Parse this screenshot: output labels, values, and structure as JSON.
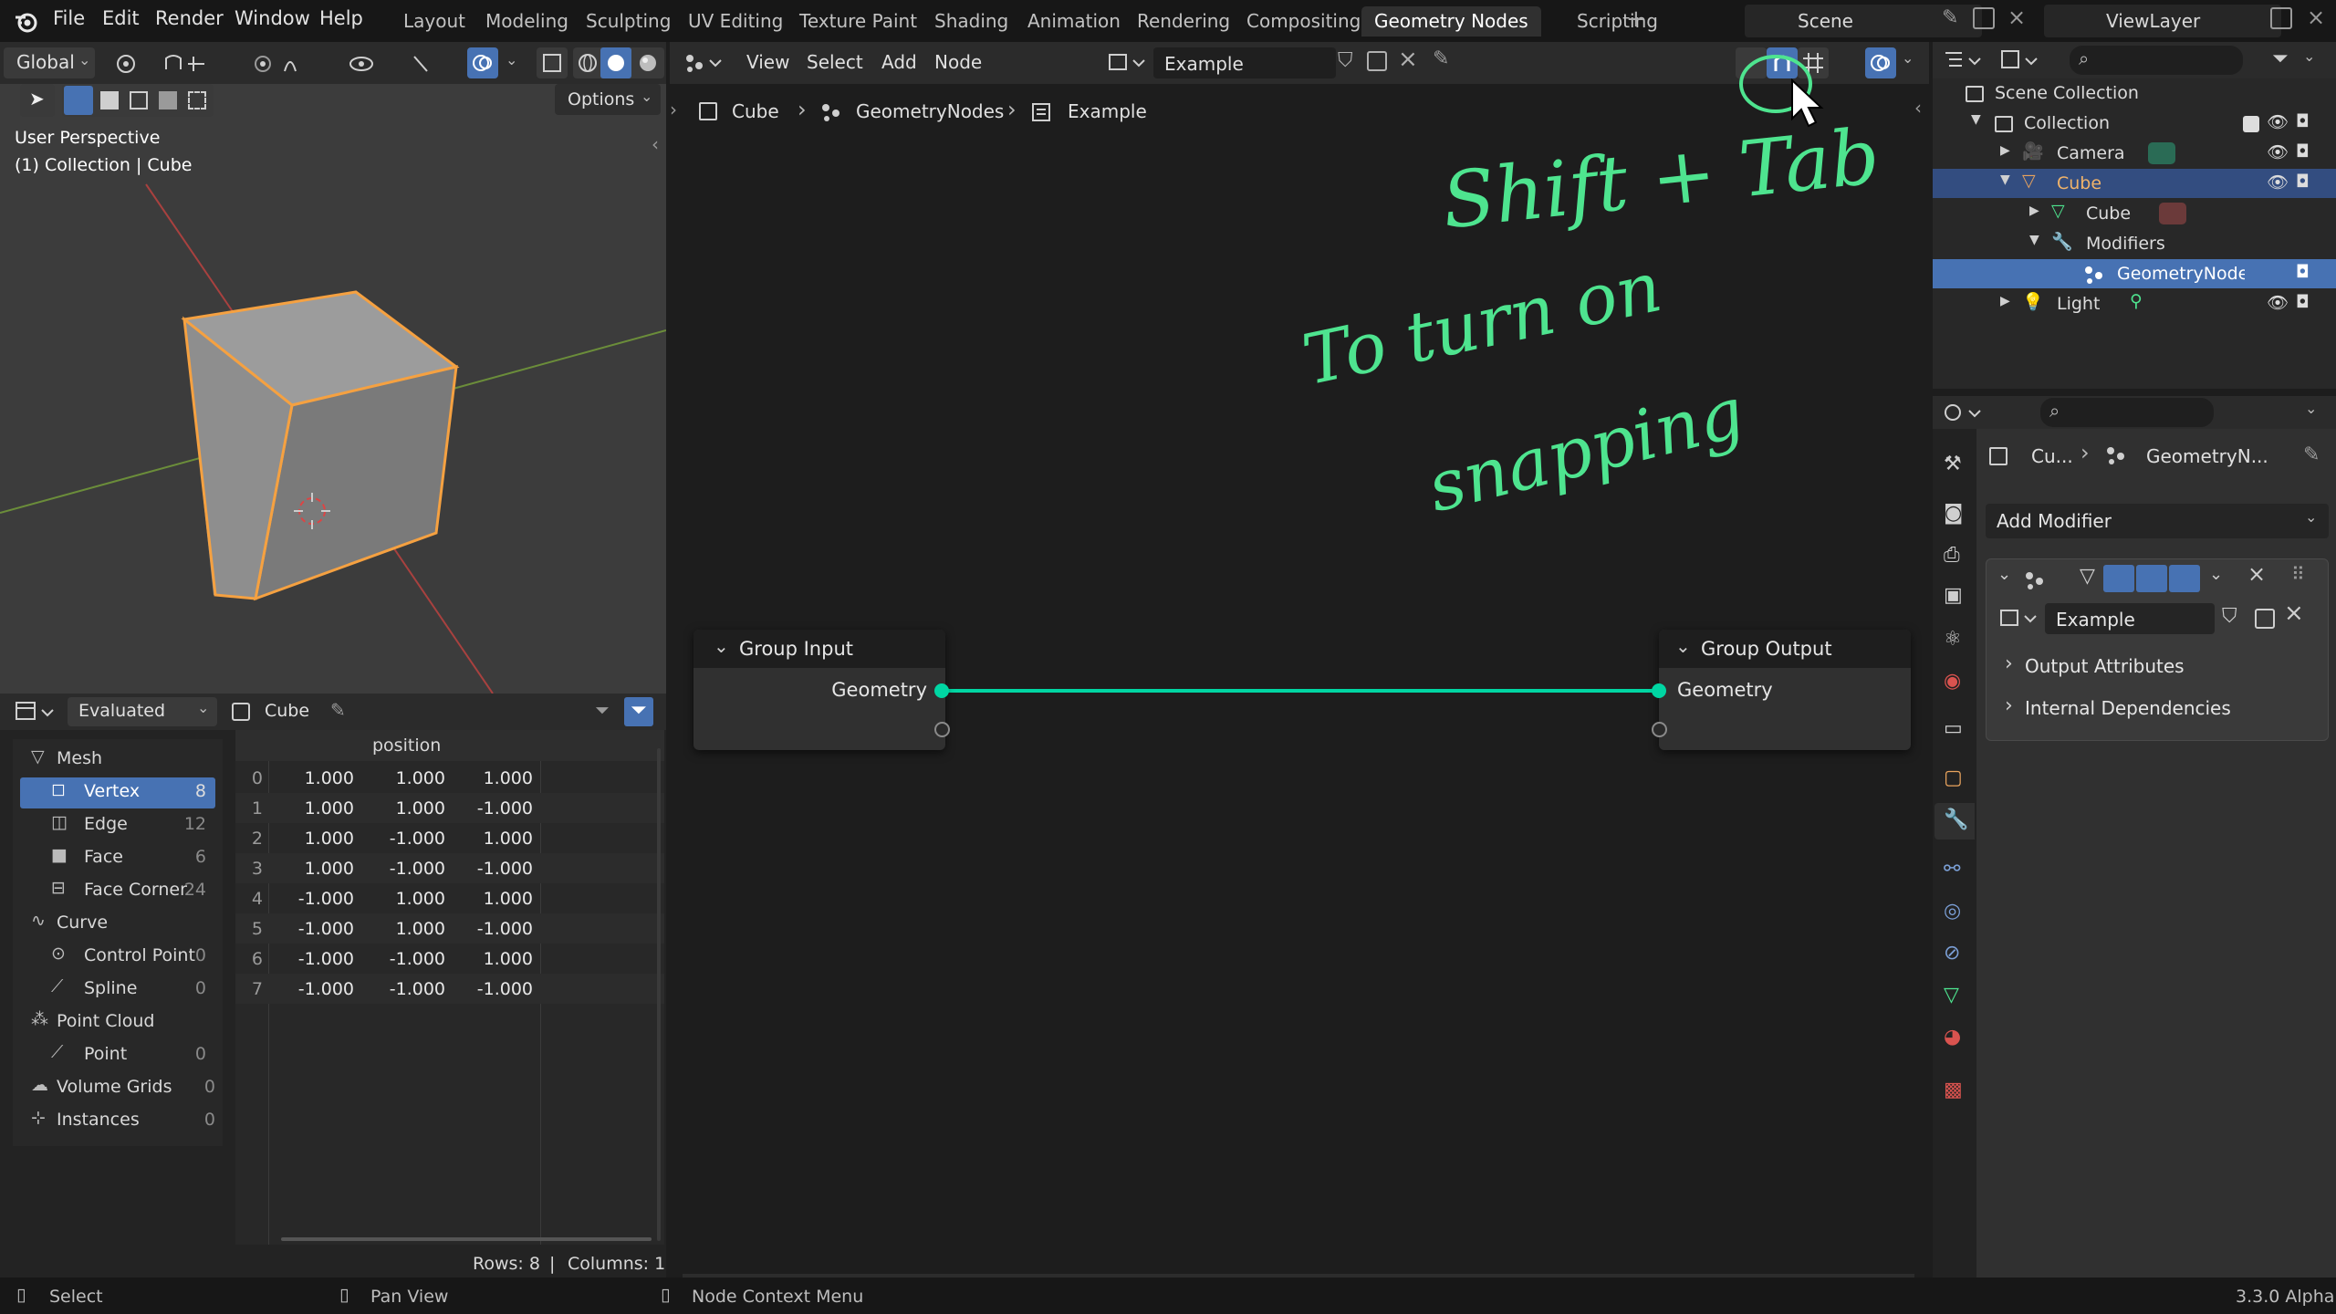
{
  "menu": {
    "file": "File",
    "edit": "Edit",
    "render": "Render",
    "window": "Window",
    "help": "Help"
  },
  "workspaces": [
    "Layout",
    "Modeling",
    "Sculpting",
    "UV Editing",
    "Texture Paint",
    "Shading",
    "Animation",
    "Rendering",
    "Compositing",
    "Geometry Nodes",
    "Scripting"
  ],
  "scene": {
    "name": "Scene",
    "view_layer": "ViewLayer"
  },
  "viewport": {
    "orientation": "Global",
    "options_label": "Options",
    "perspective_label": "User Perspective",
    "collection_label": "(1) Collection | Cube"
  },
  "node_header": {
    "view": "View",
    "select": "Select",
    "add": "Add",
    "node": "Node",
    "tree_name": "Example"
  },
  "breadcrumb": {
    "object": "Cube",
    "modifier": "GeometryNodes",
    "tree": "Example"
  },
  "annotation": {
    "line1": "Shift + Tab",
    "line2": "To turn on",
    "line3": "snapping"
  },
  "nodes": {
    "group_input": {
      "title": "Group Input",
      "socket": "Geometry"
    },
    "group_output": {
      "title": "Group Output",
      "socket": "Geometry"
    }
  },
  "spreadsheet": {
    "mode": "Evaluated",
    "object": "Cube",
    "column_header": "position",
    "tree": [
      {
        "label": "Mesh",
        "count": ""
      },
      {
        "label": "Vertex",
        "count": "8"
      },
      {
        "label": "Edge",
        "count": "12"
      },
      {
        "label": "Face",
        "count": "6"
      },
      {
        "label": "Face Corner",
        "count": "24"
      },
      {
        "label": "Curve",
        "count": ""
      },
      {
        "label": "Control Point",
        "count": "0"
      },
      {
        "label": "Spline",
        "count": "0"
      },
      {
        "label": "Point Cloud",
        "count": ""
      },
      {
        "label": "Point",
        "count": "0"
      },
      {
        "label": "Volume Grids",
        "count": "0"
      },
      {
        "label": "Instances",
        "count": "0"
      }
    ],
    "rows": [
      {
        "i": "0",
        "x": "1.000",
        "y": "1.000",
        "z": "1.000"
      },
      {
        "i": "1",
        "x": "1.000",
        "y": "1.000",
        "z": "-1.000"
      },
      {
        "i": "2",
        "x": "1.000",
        "y": "-1.000",
        "z": "1.000"
      },
      {
        "i": "3",
        "x": "1.000",
        "y": "-1.000",
        "z": "-1.000"
      },
      {
        "i": "4",
        "x": "-1.000",
        "y": "1.000",
        "z": "1.000"
      },
      {
        "i": "5",
        "x": "-1.000",
        "y": "1.000",
        "z": "-1.000"
      },
      {
        "i": "6",
        "x": "-1.000",
        "y": "-1.000",
        "z": "1.000"
      },
      {
        "i": "7",
        "x": "-1.000",
        "y": "-1.000",
        "z": "-1.000"
      }
    ],
    "footer_rows": "Rows: 8",
    "footer_sep": "|",
    "footer_cols": "Columns: 1"
  },
  "outliner": {
    "scene_collection": "Scene Collection",
    "collection": "Collection",
    "camera": "Camera",
    "cube": "Cube",
    "cube_mesh": "Cube",
    "modifiers": "Modifiers",
    "geonodes": "GeometryNode",
    "light": "Light"
  },
  "properties": {
    "breadcrumb_object": "Cu...",
    "breadcrumb_modifier": "GeometryN...",
    "add_modifier": "Add Modifier",
    "tree_name": "Example",
    "output_attributes": "Output Attributes",
    "internal_dependencies": "Internal Dependencies"
  },
  "status": {
    "select": "Select",
    "pan_view": "Pan View",
    "context_menu": "Node Context Menu",
    "version": "3.3.0 Alpha"
  },
  "colors": {
    "accent": "#4772b3",
    "geometry_socket": "#00d6a3",
    "annotation": "#4ee48f",
    "selection_orange": "#f5a141"
  }
}
